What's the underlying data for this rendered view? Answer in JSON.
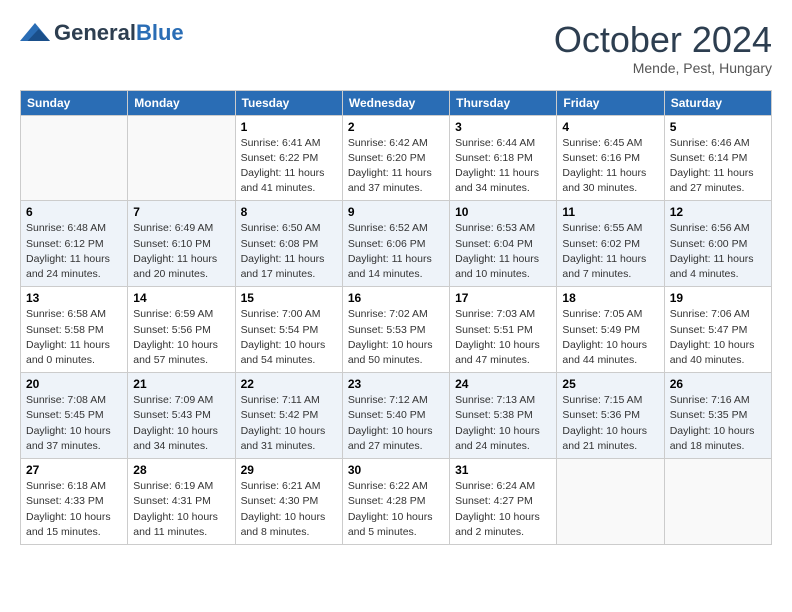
{
  "header": {
    "logo_general": "General",
    "logo_blue": "Blue",
    "month": "October 2024",
    "location": "Mende, Pest, Hungary"
  },
  "weekdays": [
    "Sunday",
    "Monday",
    "Tuesday",
    "Wednesday",
    "Thursday",
    "Friday",
    "Saturday"
  ],
  "weeks": [
    [
      {
        "day": "",
        "info": ""
      },
      {
        "day": "",
        "info": ""
      },
      {
        "day": "1",
        "info": "Sunrise: 6:41 AM\nSunset: 6:22 PM\nDaylight: 11 hours and 41 minutes."
      },
      {
        "day": "2",
        "info": "Sunrise: 6:42 AM\nSunset: 6:20 PM\nDaylight: 11 hours and 37 minutes."
      },
      {
        "day": "3",
        "info": "Sunrise: 6:44 AM\nSunset: 6:18 PM\nDaylight: 11 hours and 34 minutes."
      },
      {
        "day": "4",
        "info": "Sunrise: 6:45 AM\nSunset: 6:16 PM\nDaylight: 11 hours and 30 minutes."
      },
      {
        "day": "5",
        "info": "Sunrise: 6:46 AM\nSunset: 6:14 PM\nDaylight: 11 hours and 27 minutes."
      }
    ],
    [
      {
        "day": "6",
        "info": "Sunrise: 6:48 AM\nSunset: 6:12 PM\nDaylight: 11 hours and 24 minutes."
      },
      {
        "day": "7",
        "info": "Sunrise: 6:49 AM\nSunset: 6:10 PM\nDaylight: 11 hours and 20 minutes."
      },
      {
        "day": "8",
        "info": "Sunrise: 6:50 AM\nSunset: 6:08 PM\nDaylight: 11 hours and 17 minutes."
      },
      {
        "day": "9",
        "info": "Sunrise: 6:52 AM\nSunset: 6:06 PM\nDaylight: 11 hours and 14 minutes."
      },
      {
        "day": "10",
        "info": "Sunrise: 6:53 AM\nSunset: 6:04 PM\nDaylight: 11 hours and 10 minutes."
      },
      {
        "day": "11",
        "info": "Sunrise: 6:55 AM\nSunset: 6:02 PM\nDaylight: 11 hours and 7 minutes."
      },
      {
        "day": "12",
        "info": "Sunrise: 6:56 AM\nSunset: 6:00 PM\nDaylight: 11 hours and 4 minutes."
      }
    ],
    [
      {
        "day": "13",
        "info": "Sunrise: 6:58 AM\nSunset: 5:58 PM\nDaylight: 11 hours and 0 minutes."
      },
      {
        "day": "14",
        "info": "Sunrise: 6:59 AM\nSunset: 5:56 PM\nDaylight: 10 hours and 57 minutes."
      },
      {
        "day": "15",
        "info": "Sunrise: 7:00 AM\nSunset: 5:54 PM\nDaylight: 10 hours and 54 minutes."
      },
      {
        "day": "16",
        "info": "Sunrise: 7:02 AM\nSunset: 5:53 PM\nDaylight: 10 hours and 50 minutes."
      },
      {
        "day": "17",
        "info": "Sunrise: 7:03 AM\nSunset: 5:51 PM\nDaylight: 10 hours and 47 minutes."
      },
      {
        "day": "18",
        "info": "Sunrise: 7:05 AM\nSunset: 5:49 PM\nDaylight: 10 hours and 44 minutes."
      },
      {
        "day": "19",
        "info": "Sunrise: 7:06 AM\nSunset: 5:47 PM\nDaylight: 10 hours and 40 minutes."
      }
    ],
    [
      {
        "day": "20",
        "info": "Sunrise: 7:08 AM\nSunset: 5:45 PM\nDaylight: 10 hours and 37 minutes."
      },
      {
        "day": "21",
        "info": "Sunrise: 7:09 AM\nSunset: 5:43 PM\nDaylight: 10 hours and 34 minutes."
      },
      {
        "day": "22",
        "info": "Sunrise: 7:11 AM\nSunset: 5:42 PM\nDaylight: 10 hours and 31 minutes."
      },
      {
        "day": "23",
        "info": "Sunrise: 7:12 AM\nSunset: 5:40 PM\nDaylight: 10 hours and 27 minutes."
      },
      {
        "day": "24",
        "info": "Sunrise: 7:13 AM\nSunset: 5:38 PM\nDaylight: 10 hours and 24 minutes."
      },
      {
        "day": "25",
        "info": "Sunrise: 7:15 AM\nSunset: 5:36 PM\nDaylight: 10 hours and 21 minutes."
      },
      {
        "day": "26",
        "info": "Sunrise: 7:16 AM\nSunset: 5:35 PM\nDaylight: 10 hours and 18 minutes."
      }
    ],
    [
      {
        "day": "27",
        "info": "Sunrise: 6:18 AM\nSunset: 4:33 PM\nDaylight: 10 hours and 15 minutes."
      },
      {
        "day": "28",
        "info": "Sunrise: 6:19 AM\nSunset: 4:31 PM\nDaylight: 10 hours and 11 minutes."
      },
      {
        "day": "29",
        "info": "Sunrise: 6:21 AM\nSunset: 4:30 PM\nDaylight: 10 hours and 8 minutes."
      },
      {
        "day": "30",
        "info": "Sunrise: 6:22 AM\nSunset: 4:28 PM\nDaylight: 10 hours and 5 minutes."
      },
      {
        "day": "31",
        "info": "Sunrise: 6:24 AM\nSunset: 4:27 PM\nDaylight: 10 hours and 2 minutes."
      },
      {
        "day": "",
        "info": ""
      },
      {
        "day": "",
        "info": ""
      }
    ]
  ]
}
